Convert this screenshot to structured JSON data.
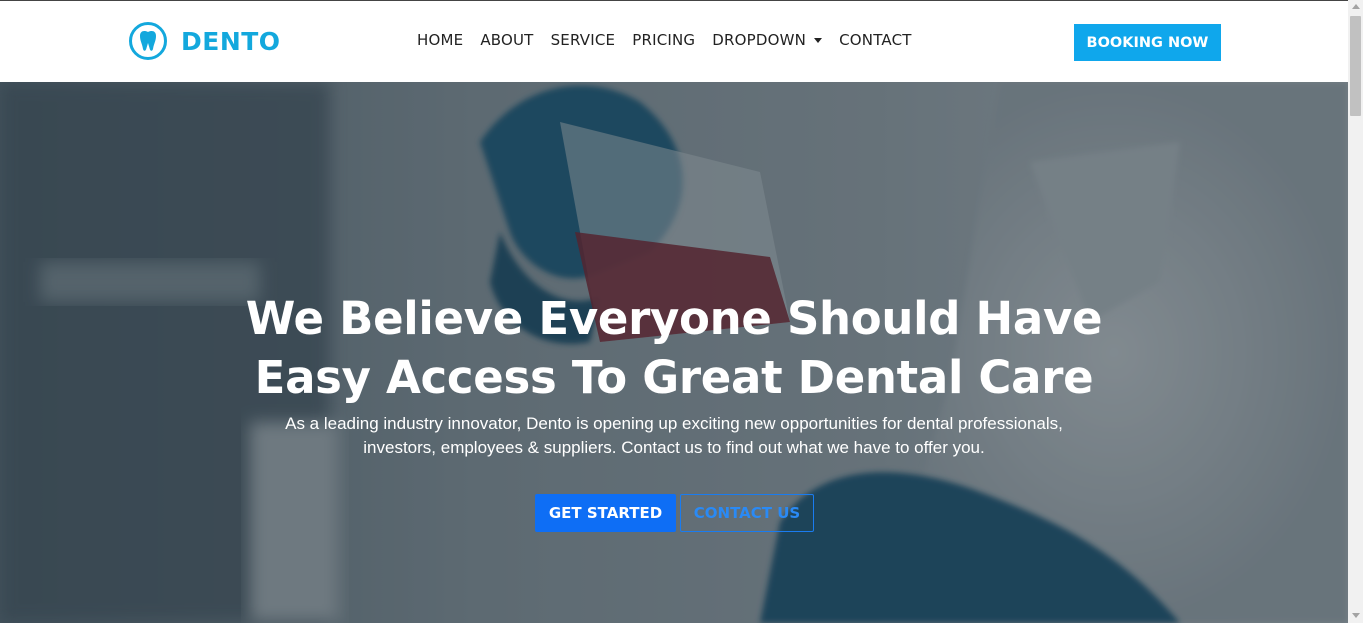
{
  "brand": {
    "name": "DENTO",
    "logo_icon": "tooth-circle-icon",
    "color": "#13a8dd"
  },
  "nav": {
    "items": [
      {
        "label": "HOME"
      },
      {
        "label": "ABOUT"
      },
      {
        "label": "SERVICE"
      },
      {
        "label": "PRICING"
      },
      {
        "label": "DROPDOWN",
        "icon": "caret-down-icon"
      },
      {
        "label": "CONTACT"
      }
    ],
    "cta": "BOOKING NOW"
  },
  "hero": {
    "title_line1": "We Believe Everyone Should Have",
    "title_line2": "Easy Access To Great Dental Care",
    "subtitle_line1": "As a leading industry innovator, Dento is opening up exciting new opportunities for dental professionals,",
    "subtitle_line2": "investors, employees & suppliers. Contact us to find out what we have to offer you.",
    "primary_button": "GET STARTED",
    "secondary_button": "CONTACT US"
  },
  "colors": {
    "accent": "#0fa7ec",
    "primary_button": "#0e6ef5",
    "overlay": "#1f2d36"
  }
}
